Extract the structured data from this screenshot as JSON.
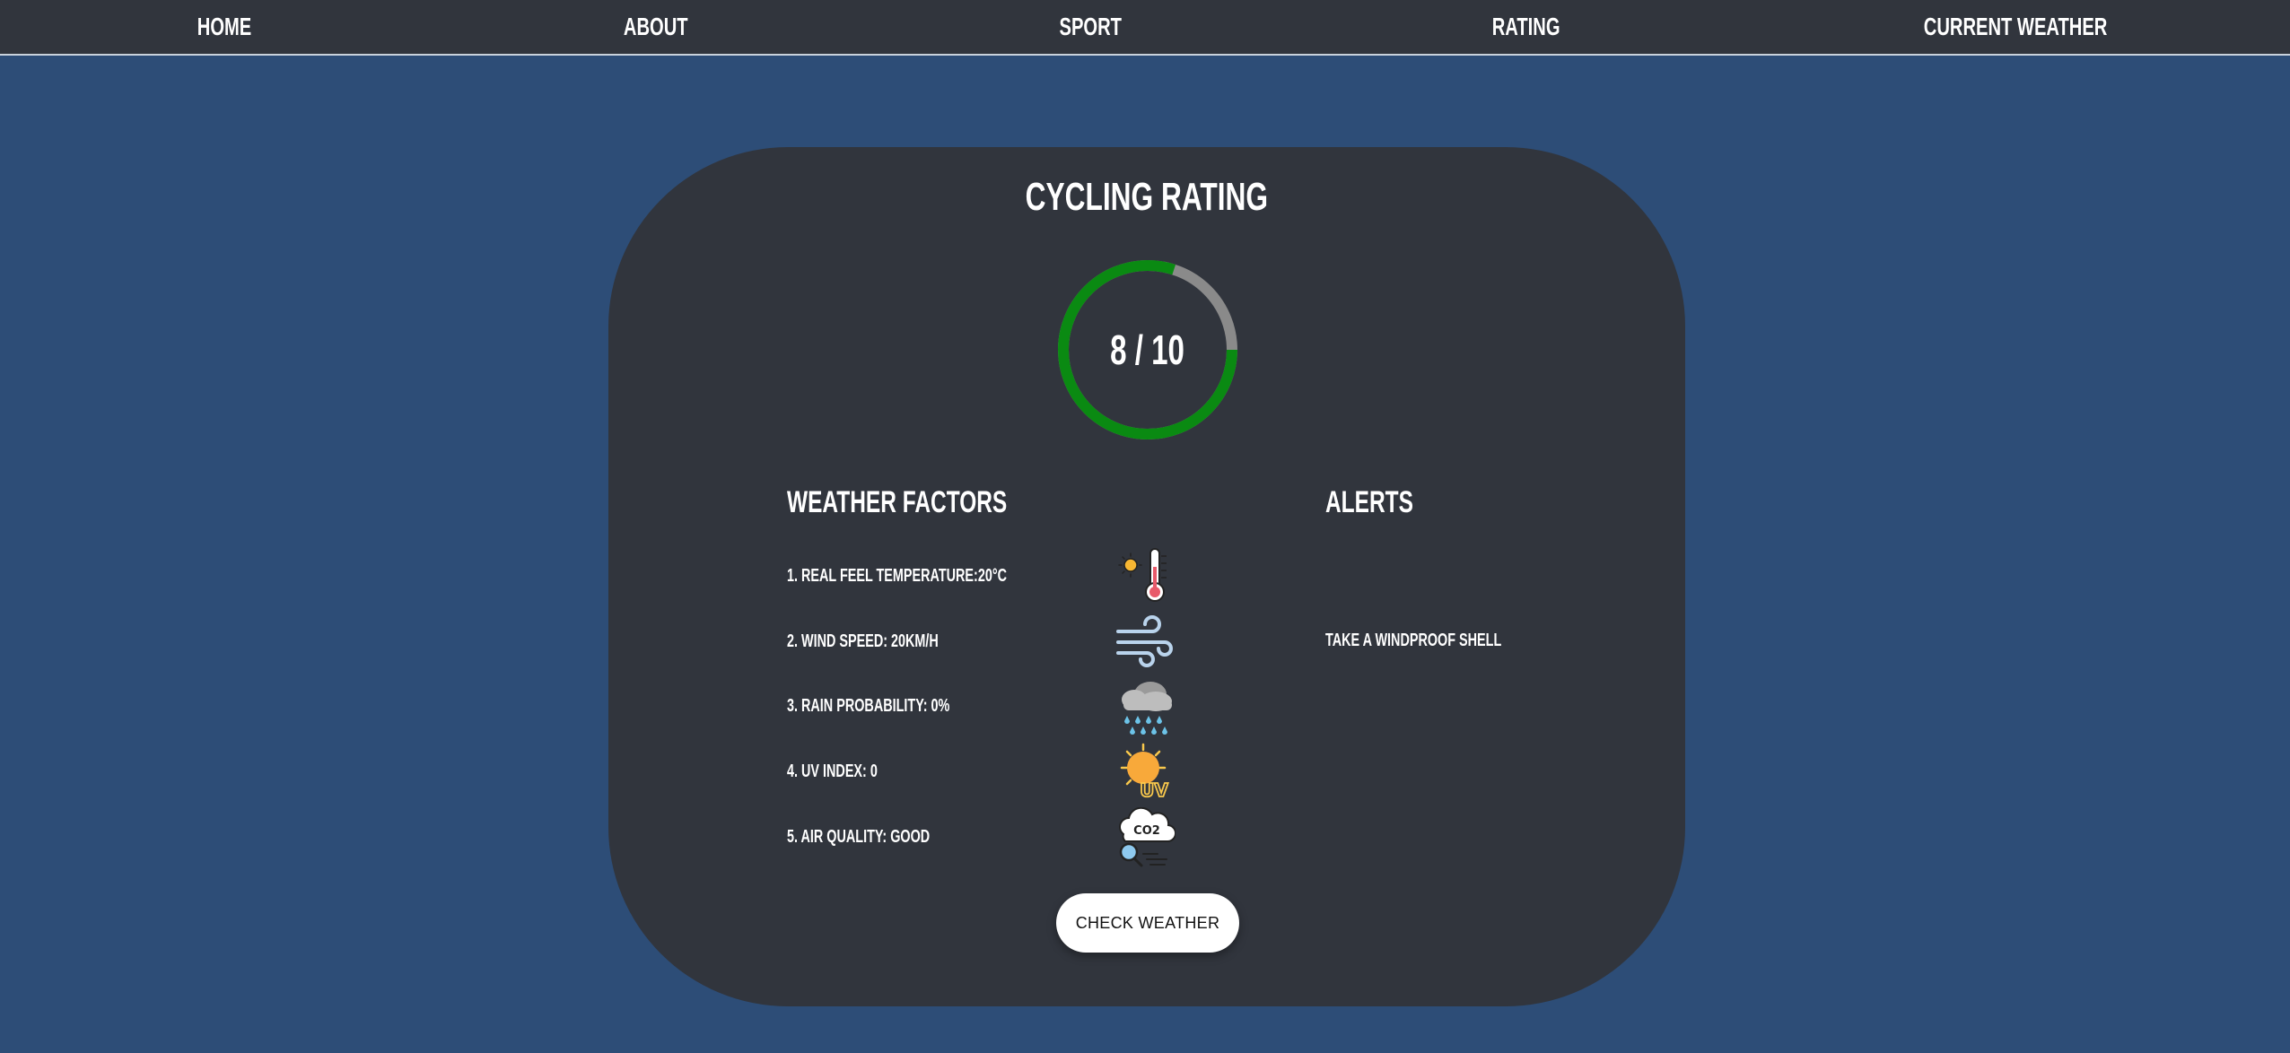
{
  "nav": {
    "items": [
      {
        "label": "HOME"
      },
      {
        "label": "ABOUT"
      },
      {
        "label": "SPORT"
      },
      {
        "label": "RATING"
      },
      {
        "label": "CURRENT WEATHER"
      }
    ]
  },
  "rating": {
    "title": "CYCLING RATING",
    "display": "8 / 10",
    "score": 8,
    "max": 10,
    "fill_color": "#0a8a12",
    "track_color": "#8a8a8a"
  },
  "factors": {
    "heading": "WEATHER FACTORS",
    "items": [
      {
        "label": "1. REAL FEEL TEMPERATURE:20°C",
        "icon": "thermometer-icon"
      },
      {
        "label": "2. WIND SPEED: 20KM/H",
        "icon": "wind-icon"
      },
      {
        "label": "3. RAIN PROBABILITY: 0%",
        "icon": "rain-cloud-icon"
      },
      {
        "label": "4. UV INDEX: 0",
        "icon": "uv-sun-icon"
      },
      {
        "label": "5. AIR QUALITY: GOOD",
        "icon": "co2-cloud-icon"
      }
    ]
  },
  "alerts": {
    "heading": "ALERTS",
    "items": [
      {
        "text": "TAKE A WINDPROOF SHELL"
      }
    ]
  },
  "actions": {
    "check_weather_label": "CHECK WEATHER"
  },
  "colors": {
    "page_background": "#2d4d77",
    "panel_background": "#31353d",
    "text": "#ffffff",
    "button_background": "#ffffff"
  }
}
